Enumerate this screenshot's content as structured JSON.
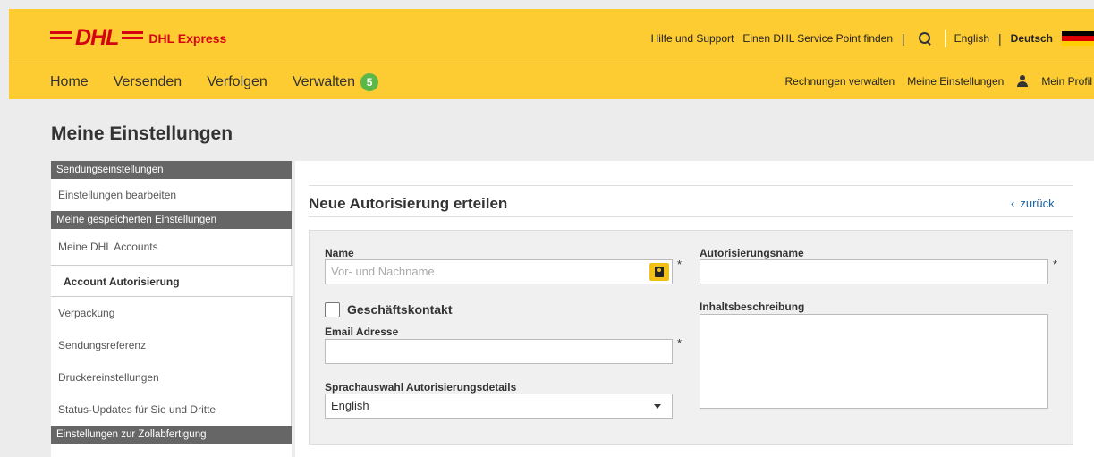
{
  "header": {
    "brand_logo": "DHL",
    "brand_product": "DHL Express",
    "util_links": [
      "Hilfe und Support",
      "Einen DHL Service Point finden"
    ],
    "lang_english": "English",
    "lang_deutsch": "Deutsch",
    "separator": "|",
    "colors": {
      "header_bg": "#fdcc33",
      "logo_red": "#d40511"
    }
  },
  "nav": {
    "home": "Home",
    "versenden": "Versenden",
    "verfolgen": "Verfolgen",
    "verwalten": "Verwalten",
    "verwalten_badge": "5",
    "right": {
      "rechnungen": "Rechnungen verwalten",
      "einstellungen": "Meine Einstellungen",
      "profil": "Mein Profil"
    }
  },
  "page": {
    "title": "Meine Einstellungen"
  },
  "sidebar": {
    "head1": "Sendungseinstellungen",
    "item_bearbeiten": "Einstellungen bearbeiten",
    "head2": "Meine gespeicherten Einstellungen",
    "items": [
      "Meine DHL Accounts",
      "Account Autorisierung",
      "Verpackung",
      "Sendungsreferenz",
      "Druckereinstellungen",
      "Status-Updates für Sie und Dritte"
    ],
    "active_index": 1,
    "head3": "Einstellungen zur Zollabfertigung"
  },
  "content": {
    "section_title": "Neue Autorisierung erteilen",
    "back_chevron": "‹",
    "back_label": "zurück",
    "form": {
      "name_label": "Name",
      "name_placeholder": "Vor- und Nachname",
      "required_mark": "*",
      "business_contact_label": "Geschäftskontakt",
      "business_contact_checked": false,
      "email_label": "Email Adresse",
      "email_value": "",
      "language_label": "Sprachauswahl Autorisierungsdetails",
      "language_value": "English",
      "auth_name_label": "Autorisierungsname",
      "auth_name_value": "",
      "description_label": "Inhaltsbeschreibung"
    }
  }
}
